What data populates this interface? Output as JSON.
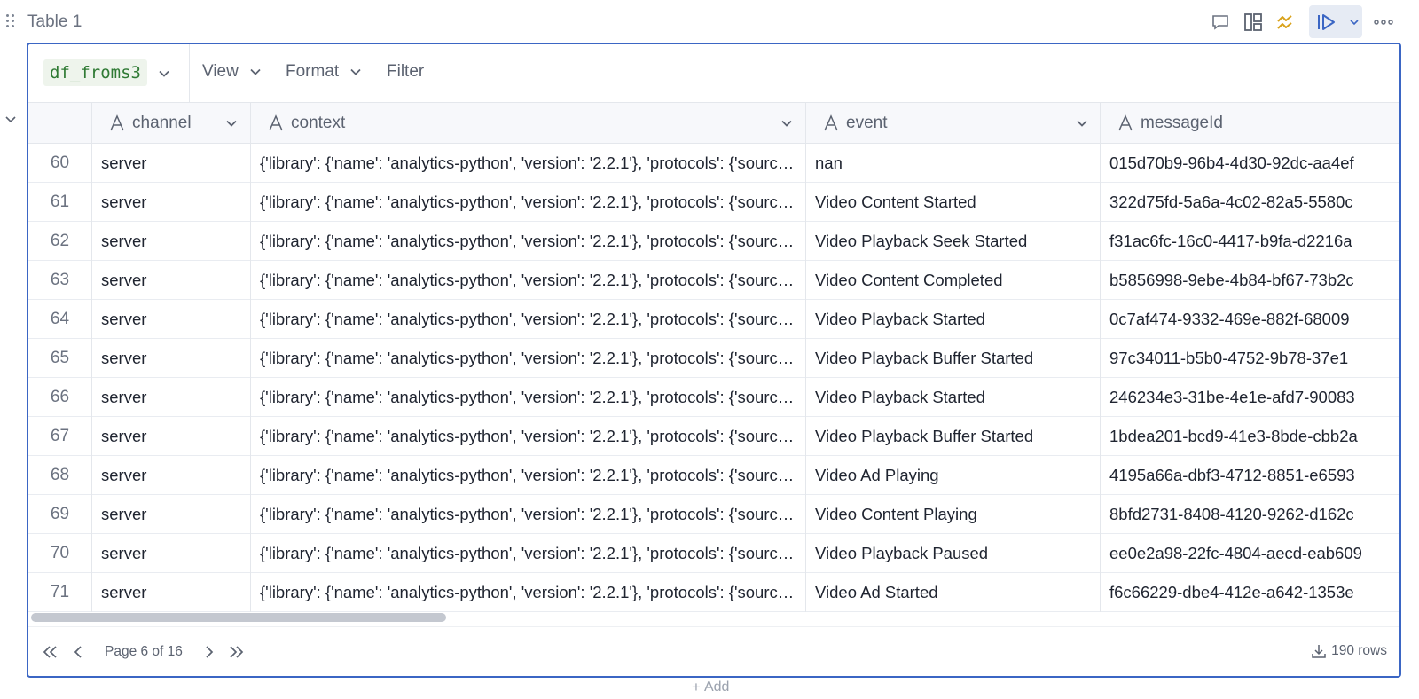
{
  "cell": {
    "title": "Table 1",
    "actions": [
      "comment-icon",
      "layout-icon",
      "explore-icon",
      "run-icon",
      "chevron-down-icon",
      "more-icon"
    ]
  },
  "toolbar": {
    "dataframe": "df_froms3",
    "view_label": "View",
    "format_label": "Format",
    "filter_label": "Filter"
  },
  "columns": [
    {
      "key": "channel",
      "label": "channel"
    },
    {
      "key": "context",
      "label": "context"
    },
    {
      "key": "event",
      "label": "event"
    },
    {
      "key": "messageId",
      "label": "messageId"
    }
  ],
  "rows": [
    {
      "idx": "60",
      "channel": "server",
      "context": "{'library': {'name': 'analytics-python', 'version': '2.2.1'}, 'protocols': {'sourceId': 'x'}}",
      "event": "nan",
      "messageId": "015d70b9-96b4-4d30-92dc-aa4ef"
    },
    {
      "idx": "61",
      "channel": "server",
      "context": "{'library': {'name': 'analytics-python', 'version': '2.2.1'}, 'protocols': {'sourceId': 'x'}}",
      "event": "Video Content Started",
      "messageId": "322d75fd-5a6a-4c02-82a5-5580c"
    },
    {
      "idx": "62",
      "channel": "server",
      "context": "{'library': {'name': 'analytics-python', 'version': '2.2.1'}, 'protocols': {'sourceId': 'x'}}",
      "event": "Video Playback Seek Started",
      "messageId": "f31ac6fc-16c0-4417-b9fa-d2216a"
    },
    {
      "idx": "63",
      "channel": "server",
      "context": "{'library': {'name': 'analytics-python', 'version': '2.2.1'}, 'protocols': {'sourceId': 'x'}}",
      "event": "Video Content Completed",
      "messageId": "b5856998-9ebe-4b84-bf67-73b2c"
    },
    {
      "idx": "64",
      "channel": "server",
      "context": "{'library': {'name': 'analytics-python', 'version': '2.2.1'}, 'protocols': {'sourceId': 'x'}}",
      "event": "Video Playback Started",
      "messageId": "0c7af474-9332-469e-882f-68009"
    },
    {
      "idx": "65",
      "channel": "server",
      "context": "{'library': {'name': 'analytics-python', 'version': '2.2.1'}, 'protocols': {'sourceId': 'x'}}",
      "event": "Video Playback Buffer Started",
      "messageId": "97c34011-b5b0-4752-9b78-37e1"
    },
    {
      "idx": "66",
      "channel": "server",
      "context": "{'library': {'name': 'analytics-python', 'version': '2.2.1'}, 'protocols': {'sourceId': 'x'}}",
      "event": "Video Playback Started",
      "messageId": "246234e3-31be-4e1e-afd7-90083"
    },
    {
      "idx": "67",
      "channel": "server",
      "context": "{'library': {'name': 'analytics-python', 'version': '2.2.1'}, 'protocols': {'sourceId': 'x'}}",
      "event": "Video Playback Buffer Started",
      "messageId": "1bdea201-bcd9-41e3-8bde-cbb2a"
    },
    {
      "idx": "68",
      "channel": "server",
      "context": "{'library': {'name': 'analytics-python', 'version': '2.2.1'}, 'protocols': {'sourceId': 'x'}}",
      "event": "Video Ad Playing",
      "messageId": "4195a66a-dbf3-4712-8851-e6593"
    },
    {
      "idx": "69",
      "channel": "server",
      "context": "{'library': {'name': 'analytics-python', 'version': '2.2.1'}, 'protocols': {'sourceId': 'x'}}",
      "event": "Video Content Playing",
      "messageId": "8bfd2731-8408-4120-9262-d162c"
    },
    {
      "idx": "70",
      "channel": "server",
      "context": "{'library': {'name': 'analytics-python', 'version': '2.2.1'}, 'protocols': {'sourceId': 'x'}}",
      "event": "Video Playback Paused",
      "messageId": "ee0e2a98-22fc-4804-aecd-eab609"
    },
    {
      "idx": "71",
      "channel": "server",
      "context": "{'library': {'name': 'analytics-python', 'version': '2.2.1'}, 'protocols': {'sourceId': 'x'}}",
      "event": "Video Ad Started",
      "messageId": "f6c66229-dbe4-412e-a642-1353e"
    }
  ],
  "pagination": {
    "page_label": "Page 6 of 16",
    "rows_label": "190 rows"
  },
  "add_label": "Add",
  "colors": {
    "frame_border": "#3b66c4",
    "df_tag_bg": "#eef4ec",
    "df_tag_text": "#2f7a34",
    "explore_icon": "#d9a21b",
    "run_icon": "#3b66c4"
  }
}
